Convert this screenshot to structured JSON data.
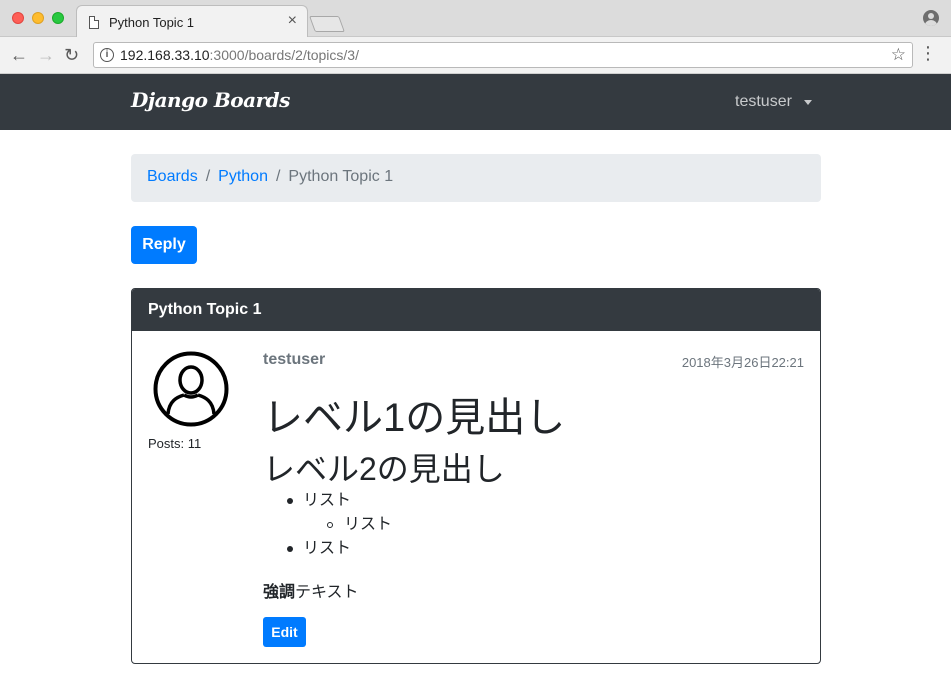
{
  "browser": {
    "tab_title": "Python Topic 1",
    "tab_close": "×",
    "url_host": "192.168.33.10",
    "url_path": ":3000/boards/2/topics/3/",
    "back_glyph": "←",
    "forward_glyph": "→",
    "reload_glyph": "↻",
    "star_glyph": "☆",
    "menu_glyph": "⋮",
    "info_glyph": "i"
  },
  "navbar": {
    "brand": "Django Boards",
    "user": "testuser"
  },
  "breadcrumb": {
    "items": [
      "Boards",
      "Python"
    ],
    "separator": "/",
    "active": "Python Topic 1"
  },
  "actions": {
    "reply_label": "Reply"
  },
  "topic": {
    "title": "Python Topic 1",
    "post": {
      "author": "testuser",
      "posts_label": "Posts: 11",
      "date": "2018年3月26日22:21",
      "heading1": "レベル1の見出し",
      "heading2": "レベル2の見出し",
      "list": [
        "リスト",
        "リスト",
        "リスト"
      ],
      "strong_text": "強調",
      "rest_text": "テキスト",
      "edit_label": "Edit"
    }
  },
  "colors": {
    "navbar": "#343a40",
    "primary": "#007bff",
    "muted": "#6c757d",
    "breadcrumb_bg": "#e9ecef"
  }
}
